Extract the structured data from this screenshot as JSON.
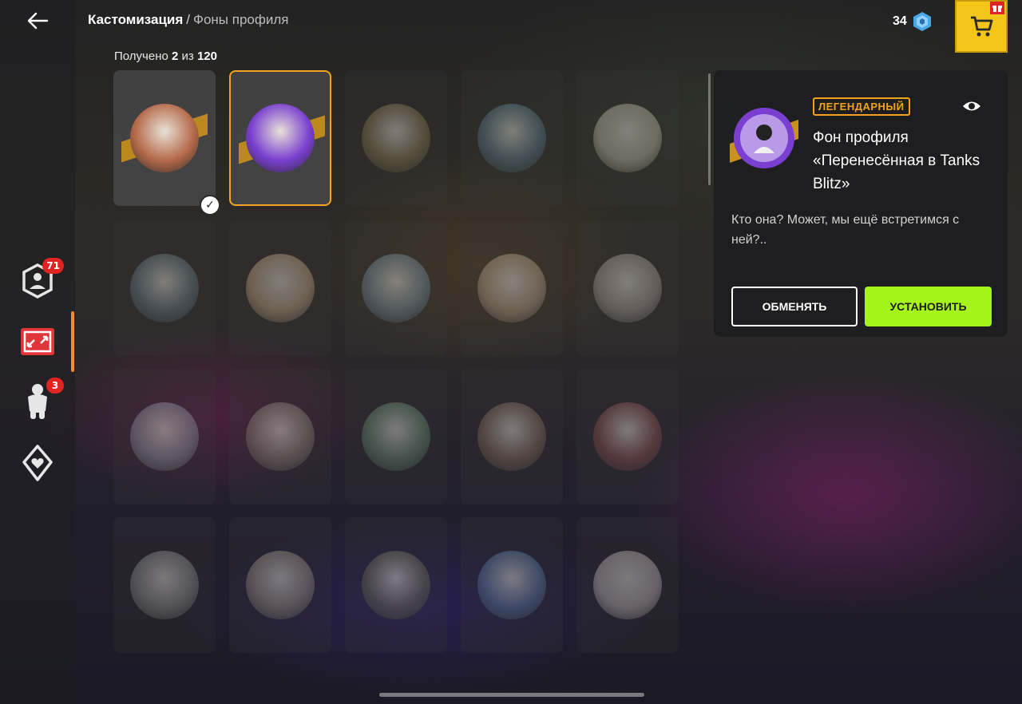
{
  "header": {
    "back_icon": "arrow-left-icon",
    "breadcrumb_main": "Кастомизация",
    "breadcrumb_sep": "/",
    "breadcrumb_current": "Фоны профиля",
    "progress_prefix": "Получено",
    "progress_owned": "2",
    "progress_mid": "из",
    "progress_total": "120"
  },
  "currency": {
    "amount": "34",
    "icon": "gem-icon",
    "color": "#4aa8e8"
  },
  "cart": {
    "icon": "cart-icon",
    "gift_icon": "gift-icon",
    "color": "#f5c518"
  },
  "sidebar": {
    "items": [
      {
        "name": "profile",
        "icon": "hex-profile-icon",
        "badge": "71"
      },
      {
        "name": "backgrounds",
        "icon": "frame-corners-icon",
        "badge": ""
      },
      {
        "name": "avatars",
        "icon": "figure-icon",
        "badge": "3"
      },
      {
        "name": "favorites",
        "icon": "heart-shield-icon",
        "badge": ""
      }
    ],
    "active_color": "#ff8a1f"
  },
  "grid": {
    "items": [
      {
        "state": "owned",
        "theme": "#b56a4a"
      },
      {
        "state": "selected",
        "theme": "#7a3fd0"
      },
      {
        "state": "locked",
        "theme": "#8a7540"
      },
      {
        "state": "locked",
        "theme": "#4a7a90"
      },
      {
        "state": "locked",
        "theme": "#b8b59a"
      },
      {
        "state": "locked",
        "theme": "#5a7a88"
      },
      {
        "state": "locked",
        "theme": "#c7a070"
      },
      {
        "state": "locked",
        "theme": "#6a8aa0"
      },
      {
        "state": "locked",
        "theme": "#b89a7a"
      },
      {
        "state": "locked",
        "theme": "#a69a90"
      },
      {
        "state": "locked",
        "theme": "#8a90a0"
      },
      {
        "state": "locked",
        "theme": "#8a8070"
      },
      {
        "state": "locked",
        "theme": "#5a8a6a"
      },
      {
        "state": "locked",
        "theme": "#8a6a50"
      },
      {
        "state": "locked",
        "theme": "#a04a4a"
      },
      {
        "state": "locked",
        "theme": "#8a8a8a"
      },
      {
        "state": "locked",
        "theme": "#9a8a7a"
      },
      {
        "state": "locked",
        "theme": "#6a6a50"
      },
      {
        "state": "locked",
        "theme": "#4a7ab0"
      },
      {
        "state": "locked",
        "theme": "#c0b0b0"
      }
    ]
  },
  "detail": {
    "rarity": "ЛЕГЕНДАРНЫЙ",
    "rarity_color": "#f2a31b",
    "eye_icon": "eye-icon",
    "title": "Фон профиля «Перенесённая в Tanks Blitz»",
    "description": "Кто она? Может, мы ещё встретимся с ней?..",
    "exchange_label": "ОБМЕНЯТЬ",
    "install_label": "УСТАНОВИТЬ",
    "install_color": "#a6f51a"
  }
}
